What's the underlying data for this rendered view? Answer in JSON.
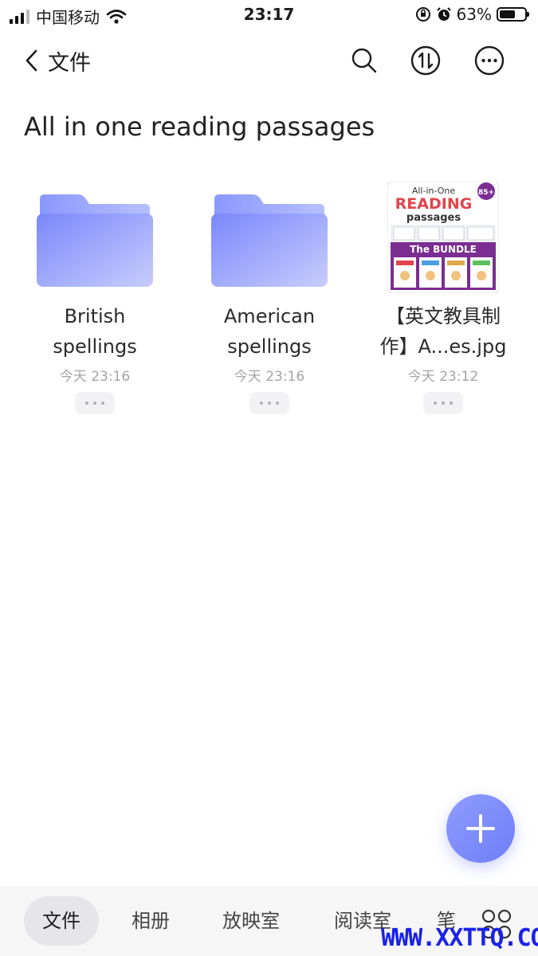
{
  "status_bar": {
    "carrier": "中国移动",
    "time": "23:17",
    "battery_percent": "63%",
    "battery_level": 0.63
  },
  "nav": {
    "back_label": "文件",
    "icons": [
      "search-icon",
      "sort-icon",
      "more-icon"
    ]
  },
  "folder_title": "All in one reading passages",
  "items": [
    {
      "type": "folder",
      "name_line1": "British",
      "name_line2": "spellings",
      "time": "今天 23:16"
    },
    {
      "type": "folder",
      "name_line1": "American",
      "name_line2": "spellings",
      "time": "今天 23:16"
    },
    {
      "type": "image",
      "name_line1": "【英文教具制",
      "name_line2": "作】A...es.jpg",
      "time": "今天 23:12",
      "thumb": {
        "line1": "All-in-One",
        "line2": "READING",
        "line3": "passages",
        "badge": "85+",
        "banner": "The BUNDLE"
      }
    }
  ],
  "tabs": [
    "文件",
    "相册",
    "放映室",
    "阅读室",
    "笔"
  ],
  "active_tab": 0,
  "watermark": "WWW.XXTTQ.COM",
  "colors": {
    "accent": "#7484f6",
    "folder": "#8a97fb",
    "thumb_purple": "#7b2d91"
  }
}
